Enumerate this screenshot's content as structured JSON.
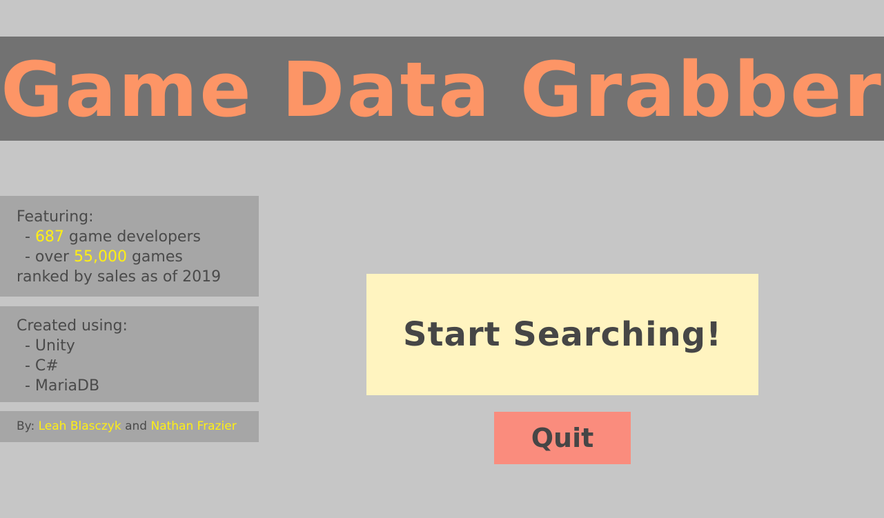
{
  "title": "Game Data Grabber",
  "features": {
    "heading": "Featuring:",
    "dev_prefix": "- ",
    "dev_count": "687",
    "dev_suffix": " game developers",
    "games_prefix": "- over ",
    "games_count": "55,000",
    "games_suffix": " games",
    "footer": "ranked by sales as of 2019"
  },
  "tech": {
    "heading": "Created using:",
    "items": [
      "- Unity",
      "- C#",
      "- MariaDB"
    ]
  },
  "credits": {
    "by_label": "By: ",
    "author1": "Leah Blasczyk",
    "joiner": " and ",
    "author2": "Nathan Frazier"
  },
  "buttons": {
    "start_label": "Start Searching!",
    "quit_label": "Quit"
  },
  "colors": {
    "background": "#c6c6c6",
    "title_bar": "#727272",
    "title_text": "#fd9566",
    "panel": "#a6a6a6",
    "highlight": "#ffef14",
    "start_button": "#fff4c0",
    "quit_button": "#fa8c7d",
    "text": "#464646"
  }
}
